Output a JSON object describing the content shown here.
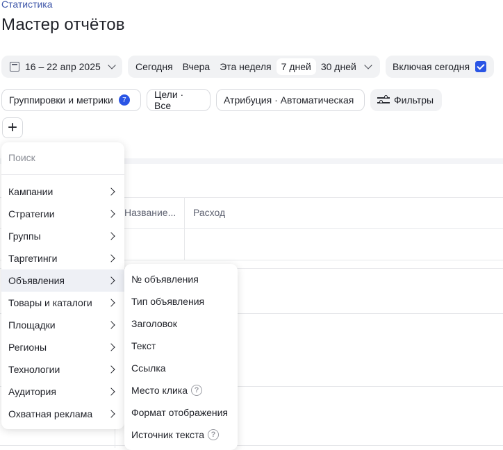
{
  "breadcrumb": "Статистика",
  "title": "Мастер отчётов",
  "date_range": "16 – 22 апр 2025",
  "periods": [
    {
      "label": "Сегодня",
      "active": false
    },
    {
      "label": "Вчера",
      "active": false
    },
    {
      "label": "Эта неделя",
      "active": false
    },
    {
      "label": "7 дней",
      "active": true
    },
    {
      "label": "30 дней",
      "active": false
    }
  ],
  "include_today": {
    "label": "Включая сегодня",
    "checked": true
  },
  "toolbar": {
    "groups_label": "Группировки и метрики",
    "groups_count": "7",
    "goals_label": "Цели · Все",
    "attribution_label": "Атрибуция · Автоматическая",
    "filters_label": "Фильтры",
    "add_symbol": "+"
  },
  "table": {
    "columns": [
      "Название...",
      "Расход"
    ]
  },
  "menu": {
    "search_placeholder": "Поиск",
    "items": [
      "Кампании",
      "Стратегии",
      "Группы",
      "Таргетинги",
      "Объявления",
      "Товары и каталоги",
      "Площадки",
      "Регионы",
      "Технологии",
      "Аудитория",
      "Охватная реклама"
    ],
    "active_index": 4
  },
  "submenu": {
    "items": [
      {
        "label": "№ объявления",
        "help": false
      },
      {
        "label": "Тип объявления",
        "help": false
      },
      {
        "label": "Заголовок",
        "help": false
      },
      {
        "label": "Текст",
        "help": false
      },
      {
        "label": "Ссылка",
        "help": false
      },
      {
        "label": "Место клика",
        "help": true
      },
      {
        "label": "Формат отображения",
        "help": false
      },
      {
        "label": "Источник текста",
        "help": true
      }
    ]
  },
  "colors": {
    "accent": "#2a55e5",
    "pill_bg": "#f1f2f4",
    "active_item_bg": "#eef0f5"
  }
}
